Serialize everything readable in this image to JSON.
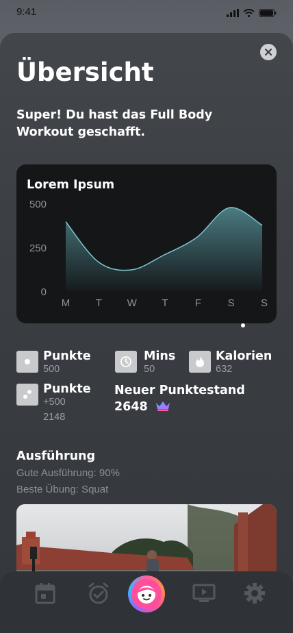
{
  "status_bar": {
    "time": "9:41"
  },
  "header": {
    "title": "Übersicht",
    "subtitle": "Super! Du hast das Full Body Workout geschafft."
  },
  "chart_data": {
    "type": "area",
    "title": "Lorem Ipsum",
    "categories": [
      "M",
      "T",
      "W",
      "T",
      "F",
      "S",
      "S"
    ],
    "y_ticks": [
      "500",
      "250",
      "0"
    ],
    "ylim": [
      0,
      500
    ],
    "values": [
      400,
      170,
      125,
      210,
      310,
      480,
      380
    ],
    "grid": false,
    "colors": {
      "line": "#7ec6cc",
      "fill_top": "#4a7b80",
      "fill_bottom": "#15191c"
    }
  },
  "stats": [
    {
      "label": "Punkte",
      "value": "500",
      "icon": "circle-dot-icon"
    },
    {
      "label": "Mins",
      "value": "50",
      "icon": "clock-icon"
    },
    {
      "label": "Kalorien",
      "value": "632",
      "icon": "flame-icon"
    },
    {
      "label": "Punkte",
      "value": "+500",
      "value2": "2148",
      "icon": "dots-icon"
    }
  ],
  "new_score": {
    "label": "Neuer Punktestand",
    "value": "2648",
    "icon": "crown-icon"
  },
  "execution": {
    "title": "Ausführung",
    "line1": "Gute Ausführung: 90%",
    "line2": "Beste Übung: Squat"
  },
  "tabs": [
    {
      "name": "calendar",
      "icon": "calendar-icon"
    },
    {
      "name": "alarm",
      "icon": "alarm-check-icon"
    },
    {
      "name": "avatar",
      "icon": "face-icon"
    },
    {
      "name": "video",
      "icon": "play-screen-icon"
    },
    {
      "name": "settings",
      "icon": "gear-icon"
    }
  ],
  "colors": {
    "accent": "#ff4f9a",
    "crown": "#7b6cff"
  }
}
